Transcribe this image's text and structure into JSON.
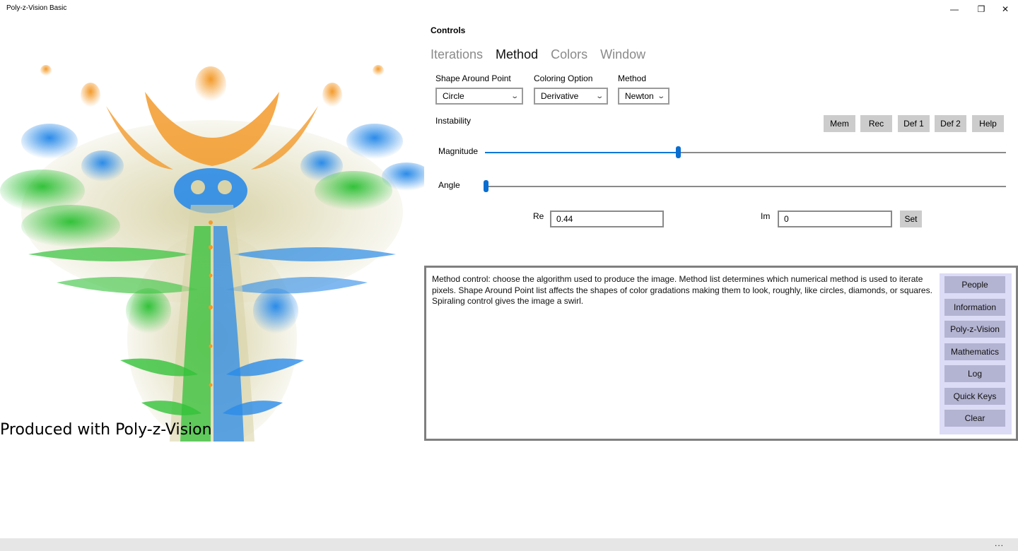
{
  "window": {
    "title": "Poly-z-Vision Basic",
    "minimize": "—",
    "maximize": "❐",
    "close": "✕"
  },
  "fractal": {
    "watermark": "Produced with Poly-z-Vision",
    "colors": {
      "orange": "#f39a2a",
      "green": "#33c23a",
      "blue": "#2b8be8",
      "cream": "#d8d3a8"
    }
  },
  "controls": {
    "heading": "Controls",
    "tabs": [
      {
        "label": "Iterations",
        "active": false
      },
      {
        "label": "Method",
        "active": true
      },
      {
        "label": "Colors",
        "active": false
      },
      {
        "label": "Window",
        "active": false
      }
    ],
    "shape": {
      "label": "Shape Around Point",
      "value": "Circle"
    },
    "coloring": {
      "label": "Coloring Option",
      "value": "Derivative"
    },
    "method": {
      "label": "Method",
      "value": "Newton"
    },
    "instability_label": "Instability",
    "buttons": {
      "mem": "Mem",
      "rec": "Rec",
      "def1": "Def 1",
      "def2": "Def 2",
      "help": "Help"
    },
    "magnitude": {
      "label": "Magnitude",
      "fraction": 0.37
    },
    "angle": {
      "label": "Angle",
      "fraction": 0.0
    },
    "re": {
      "label": "Re",
      "value": "0.44"
    },
    "im": {
      "label": "Im",
      "value": "0"
    },
    "set_label": "Set",
    "accent": "#0078d7"
  },
  "info": {
    "text": "Method control: choose the algorithm used to produce the image. Method list determines which numerical method is used to iterate pixels. Shape Around Point list affects the shapes of color gradations making them to look, roughly, like circles, diamonds, or squares. Spiraling control gives the image a swirl.",
    "buttons": [
      "People",
      "Information",
      "Poly-z-Vision",
      "Mathematics",
      "Log",
      "Quick Keys",
      "Clear"
    ]
  },
  "appbar": {
    "more": "..."
  }
}
